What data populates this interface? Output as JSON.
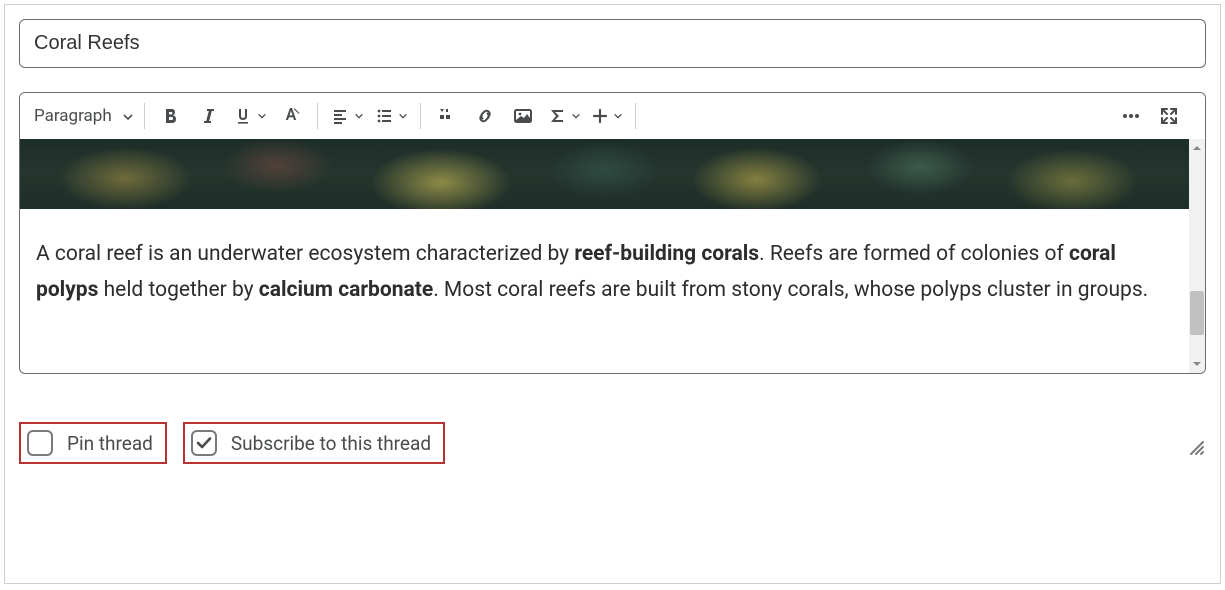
{
  "title_value": "Coral Reefs",
  "toolbar": {
    "style_label": "Paragraph"
  },
  "content": {
    "p1_a": "A coral reef is an underwater ecosystem characterized by ",
    "p1_b1": "reef-building corals",
    "p1_c": ". Reefs are formed of colonies of ",
    "p1_b2": "coral polyps",
    "p1_d": " held together by ",
    "p1_b3": "calcium carbonate",
    "p1_e": ". Most coral reefs are built from stony corals, whose polyps cluster in groups."
  },
  "checkboxes": {
    "pin_label": "Pin thread",
    "pin_checked": false,
    "subscribe_label": "Subscribe to this thread",
    "subscribe_checked": true
  }
}
